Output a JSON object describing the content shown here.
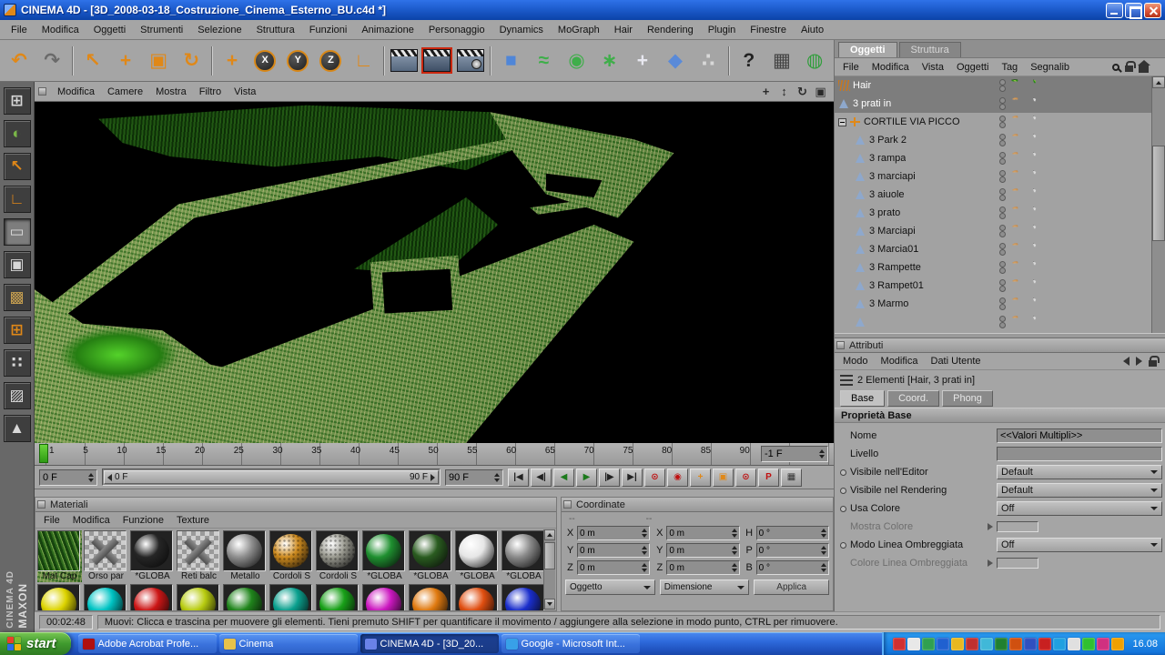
{
  "window": {
    "title": "CINEMA 4D - [3D_2008-03-18_Costruzione_Cinema_Esterno_BU.c4d *]"
  },
  "menubar": {
    "items": [
      "File",
      "Modifica",
      "Oggetti",
      "Strumenti",
      "Selezione",
      "Struttura",
      "Funzioni",
      "Animazione",
      "Personaggio",
      "Dynamics",
      "MoGraph",
      "Hair",
      "Rendering",
      "Plugin",
      "Finestre",
      "Aiuto"
    ]
  },
  "toolbar": {
    "items": [
      {
        "name": "undo-icon",
        "glyph": "↶",
        "color": "#e08818"
      },
      {
        "name": "redo-icon",
        "glyph": "↷",
        "color": "#6a6a6a"
      },
      {
        "name": "toolbar-separator",
        "sep": true
      },
      {
        "name": "live-selection-icon",
        "glyph": "↖",
        "color": "#e08818"
      },
      {
        "name": "move-icon",
        "glyph": "+",
        "color": "#e08818"
      },
      {
        "name": "scale-icon",
        "glyph": "▣",
        "color": "#e08818"
      },
      {
        "name": "rotate-icon",
        "glyph": "↻",
        "color": "#e08818"
      },
      {
        "name": "toolbar-separator",
        "sep": true
      },
      {
        "name": "axis-move-icon",
        "glyph": "+",
        "color": "#e08818"
      },
      {
        "name": "lock-x-button",
        "glyph": "X",
        "axis": true
      },
      {
        "name": "lock-y-button",
        "glyph": "Y",
        "axis": true
      },
      {
        "name": "lock-z-button",
        "glyph": "Z",
        "axis": true
      },
      {
        "name": "coordinate-system-icon",
        "glyph": "∟",
        "color": "#e08818"
      },
      {
        "name": "toolbar-separator",
        "sep": true
      },
      {
        "name": "render-view-button",
        "clap": true
      },
      {
        "name": "render-active-button",
        "clap": true,
        "active": true
      },
      {
        "name": "render-settings-button",
        "clap": true,
        "gear": true
      },
      {
        "name": "toolbar-separator",
        "sep": true
      },
      {
        "name": "add-primitive-button",
        "glyph": "■",
        "color": "#4f86d8"
      },
      {
        "name": "add-spline-button",
        "glyph": "≈",
        "color": "#3fae4a"
      },
      {
        "name": "add-nurbs-button",
        "glyph": "◉",
        "color": "#3fae4a"
      },
      {
        "name": "add-modeling-button",
        "glyph": "∗",
        "color": "#3fae4a"
      },
      {
        "name": "add-deformer-button",
        "glyph": "+",
        "color": "#e8e8f0"
      },
      {
        "name": "add-environment-button",
        "glyph": "◆",
        "color": "#5a8ad8"
      },
      {
        "name": "add-particles-button",
        "glyph": "∴",
        "color": "#d8d8d8"
      },
      {
        "name": "toolbar-separator",
        "sep": true
      },
      {
        "name": "help-button",
        "glyph": "?",
        "color": "#222222"
      },
      {
        "name": "layout-button",
        "glyph": "▦",
        "color": "#444444"
      },
      {
        "name": "globe-button",
        "glyph": "◍",
        "color": "#2f9e3a"
      }
    ]
  },
  "sidebar": {
    "items": [
      {
        "name": "viewport-layout-icon",
        "glyph": "⊞",
        "color": "#d8d8d8"
      },
      {
        "name": "world-grid-icon",
        "glyph": "◐",
        "color": "#7ab648"
      },
      {
        "name": "texture-axis-icon",
        "glyph": "↖",
        "color": "#e08818"
      },
      {
        "name": "object-axis-icon",
        "glyph": "∟",
        "color": "#e08818"
      },
      {
        "name": "convert-editable-icon",
        "glyph": "▭",
        "color": "#d8d8d8",
        "pressed": true
      },
      {
        "name": "model-mode-icon",
        "glyph": "▣",
        "color": "#d8d8d8"
      },
      {
        "name": "texture-mode-icon",
        "glyph": "▩",
        "color": "#c8a050"
      },
      {
        "name": "workplane-mode-icon",
        "glyph": "⊞",
        "color": "#e08818"
      },
      {
        "name": "points-mode-icon",
        "glyph": "∷",
        "color": "#d8d8d8"
      },
      {
        "name": "edges-mode-icon",
        "glyph": "▨",
        "color": "#d8d8d8"
      },
      {
        "name": "polygons-mode-icon",
        "glyph": "▲",
        "color": "#d8d8d8"
      }
    ],
    "brand_line1": "MAXON",
    "brand_line2": "CINEMA 4D"
  },
  "viewport": {
    "menu": [
      "Modifica",
      "Camere",
      "Mostra",
      "Filtro",
      "Vista"
    ],
    "nav_icons": [
      {
        "name": "viewport-pan-icon",
        "glyph": "+"
      },
      {
        "name": "viewport-zoom-icon",
        "glyph": "↕"
      },
      {
        "name": "viewport-rotate-icon",
        "glyph": "↻"
      },
      {
        "name": "viewport-maximize-icon",
        "glyph": "▣"
      }
    ]
  },
  "timeline": {
    "ticks": [
      "1",
      "5",
      "10",
      "15",
      "20",
      "25",
      "30",
      "35",
      "40",
      "45",
      "50",
      "55",
      "60",
      "65",
      "70",
      "75",
      "80",
      "85",
      "90"
    ],
    "frame_field": "-1 F",
    "start_field": "0 F",
    "slider_left_label": "0 F",
    "slider_right_label": "90 F",
    "end_field": "90 F",
    "transport": [
      {
        "name": "goto-start-button",
        "glyph": "|◀"
      },
      {
        "name": "prev-key-button",
        "glyph": "◀|"
      },
      {
        "name": "play-reverse-button",
        "glyph": "◀",
        "color": "#1c7a1c"
      },
      {
        "name": "play-button",
        "glyph": "▶",
        "color": "#1c7a1c"
      },
      {
        "name": "next-key-button",
        "glyph": "|▶"
      },
      {
        "name": "goto-end-button",
        "glyph": "▶|"
      },
      {
        "name": "record-button",
        "glyph": "⊙",
        "color": "#c01010"
      },
      {
        "name": "autokey-button",
        "glyph": "◉",
        "color": "#c01010"
      },
      {
        "name": "key-position-button",
        "glyph": "+",
        "color": "#e08818"
      },
      {
        "name": "key-scale-button",
        "glyph": "▣",
        "color": "#e08818"
      },
      {
        "name": "key-rotation-button",
        "glyph": "⊙",
        "color": "#c01010"
      },
      {
        "name": "key-parameter-button",
        "glyph": "P",
        "color": "#c01010"
      },
      {
        "name": "key-pla-button",
        "glyph": "▦",
        "color": "#333333"
      }
    ]
  },
  "materials": {
    "title": "Materiali",
    "menu": [
      "File",
      "Modifica",
      "Funzione",
      "Texture"
    ],
    "items": [
      {
        "label": "Mat Cap",
        "kind_grass": true
      },
      {
        "label": "Orso par",
        "kind_alpha": true
      },
      {
        "label": "*GLOBA",
        "kind_sphere": true,
        "color": "#262626"
      },
      {
        "label": "Reti balc",
        "kind_alpha": true
      },
      {
        "label": "Metallo",
        "kind_sphere": true,
        "color": "#8e8e8e"
      },
      {
        "label": "Cordoli S",
        "kind_sphere": true,
        "color": "#cd8a1e",
        "dotted": true
      },
      {
        "label": "Cordoli S",
        "kind_sphere": true,
        "color": "#9a9a90",
        "dotted": true
      },
      {
        "label": "*GLOBA",
        "kind_sphere": true,
        "color": "#1f9030"
      },
      {
        "label": "*GLOBA",
        "kind_sphere": true,
        "color": "#2a5c20"
      },
      {
        "label": "*GLOBA",
        "kind_sphere": true,
        "color": "#e6e6e6"
      },
      {
        "label": "*GLOBA",
        "kind_sphere": true,
        "color": "#8a8a8a"
      }
    ],
    "partial_row": [
      {
        "color": "#ddd400"
      },
      {
        "color": "#00c4c4"
      },
      {
        "color": "#cc1616"
      },
      {
        "color": "#b8cc10"
      },
      {
        "color": "#20851c"
      },
      {
        "color": "#0aa08e"
      },
      {
        "color": "#18a018"
      },
      {
        "color": "#cc18c0"
      },
      {
        "color": "#e07a10"
      },
      {
        "color": "#e04e10"
      },
      {
        "color": "#1a2ecc"
      }
    ]
  },
  "coordinates": {
    "title": "Coordinate",
    "placeholder_left": "--",
    "placeholder_mid": "--",
    "position": [
      {
        "axis": "X",
        "value": "0 m"
      },
      {
        "axis": "Y",
        "value": "0 m"
      },
      {
        "axis": "Z",
        "value": "0 m"
      }
    ],
    "size": [
      {
        "axis": "X",
        "value": "0 m"
      },
      {
        "axis": "Y",
        "value": "0 m"
      },
      {
        "axis": "Z",
        "value": "0 m"
      }
    ],
    "rotation": [
      {
        "axis": "H",
        "value": "0 °"
      },
      {
        "axis": "P",
        "value": "0 °"
      },
      {
        "axis": "B",
        "value": "0 °"
      }
    ],
    "mode_dropdown": "Oggetto",
    "size_dropdown": "Dimensione",
    "apply_button": "Applica"
  },
  "object_manager": {
    "tabs": [
      {
        "label": "Oggetti",
        "active": true
      },
      {
        "label": "Struttura",
        "active": false
      }
    ],
    "menu": [
      "File",
      "Modifica",
      "Vista",
      "Oggetti",
      "Tag",
      "Segnalib"
    ],
    "tree": [
      {
        "label": "Hair",
        "selected": true,
        "icon_hair": true,
        "green_tags": true
      },
      {
        "label": "3 prati in",
        "selected": true,
        "icon_poly": true
      },
      {
        "label": "CORTILE VIA PICCO",
        "expander": true,
        "icon_null": true
      },
      {
        "label": "3 Park 2",
        "child": true,
        "icon_poly": true
      },
      {
        "label": "3 rampa",
        "child": true,
        "icon_poly": true
      },
      {
        "label": "3 marciapi",
        "child": true,
        "icon_poly": true
      },
      {
        "label": "3 aiuole",
        "child": true,
        "icon_poly": true
      },
      {
        "label": "3 prato",
        "child": true,
        "icon_poly": true
      },
      {
        "label": "3 Marciapi",
        "child": true,
        "icon_poly": true
      },
      {
        "label": "3 Marcia01",
        "child": true,
        "icon_poly": true
      },
      {
        "label": "3 Rampette",
        "child": true,
        "icon_poly": true
      },
      {
        "label": "3 Rampet01",
        "child": true,
        "icon_poly": true
      },
      {
        "label": "3 Marmo",
        "child": true,
        "icon_poly": true
      },
      {
        "label": "",
        "child": true,
        "icon_poly": true
      }
    ]
  },
  "attributes": {
    "title": "Attributi",
    "menu": [
      "Modo",
      "Modifica",
      "Dati Utente"
    ],
    "selection_info": "2 Elementi [Hair, 3 prati in]",
    "tabs": [
      {
        "label": "Base",
        "active": true
      },
      {
        "label": "Coord.",
        "active": false
      },
      {
        "label": "Phong",
        "active": false
      }
    ],
    "section_title": "Proprietà Base",
    "rows": [
      {
        "label": "Nome",
        "textfield": true,
        "value": "<<Valori Multipli>>"
      },
      {
        "label": "Livello",
        "textfield": true,
        "value": ""
      },
      {
        "label": "Visibile nell'Editor",
        "dropdown": true,
        "value": "Default",
        "dot": true
      },
      {
        "label": "Visibile nel Rendering",
        "dropdown": true,
        "value": "Default",
        "dot": true
      },
      {
        "label": "Usa Colore",
        "dropdown": true,
        "value": "Off",
        "dot": true
      },
      {
        "label": "Mostra Colore",
        "swatch": true,
        "disabled": true,
        "arrow": true
      },
      {
        "label": "Modo Linea Ombreggiata",
        "dropdown": true,
        "value": "Off",
        "dot": true
      },
      {
        "label": "Colore Linea Ombreggiata",
        "swatch": true,
        "disabled": true,
        "arrow": true
      }
    ]
  },
  "statusbar": {
    "time": "00:02:48",
    "message": "Muovi: Clicca e trascina per muovere gli elementi. Tieni premuto SHIFT per quantificare il movimento / aggiungere alla selezione in modo punto, CTRL per rimuovere."
  },
  "taskbar": {
    "start_label": "start",
    "start_flag_colors": [
      "#e8402a",
      "#7dbb2f",
      "#2e6ae8",
      "#f3b50f"
    ],
    "buttons": [
      {
        "label": "Adobe Acrobat Profe...",
        "color": "#b01010"
      },
      {
        "label": "Cinema",
        "color": "#e8c24a"
      },
      {
        "label": "CINEMA 4D - [3D_20...",
        "color": "#6a82e8",
        "active": true
      },
      {
        "label": "Google - Microsoft Int...",
        "color": "#38a0e8"
      }
    ],
    "tray_icons": [
      {
        "color": "#d03030"
      },
      {
        "color": "#e8e8e8"
      },
      {
        "color": "#30a050"
      },
      {
        "color": "#2060d0"
      },
      {
        "color": "#e8b820"
      },
      {
        "color": "#c03030"
      },
      {
        "color": "#40b8d8"
      },
      {
        "color": "#208030"
      },
      {
        "color": "#d05010"
      },
      {
        "color": "#3050c0"
      },
      {
        "color": "#c82020"
      },
      {
        "color": "#20a0e0"
      },
      {
        "color": "#e0e0e0"
      },
      {
        "color": "#30c030"
      },
      {
        "color": "#d03080"
      },
      {
        "color": "#f0a000"
      }
    ],
    "clock": "16.08"
  }
}
